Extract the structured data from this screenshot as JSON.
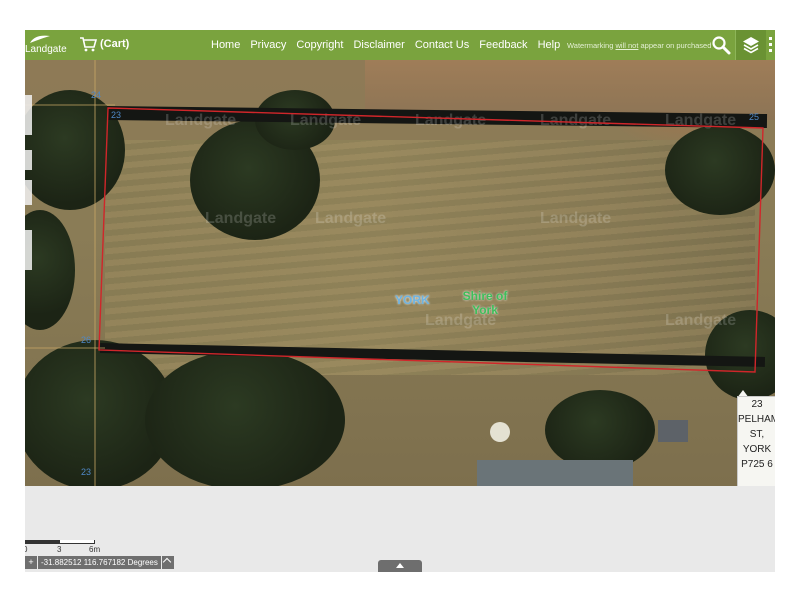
{
  "topbar": {
    "logo_text": "Landgate",
    "cart_label": "(Cart)",
    "nav": [
      "Home",
      "Privacy",
      "Copyright",
      "Disclaimer",
      "Contact Us",
      "Feedback",
      "Help"
    ],
    "watermark_notice": {
      "before": "Watermarking ",
      "emphasis": "will not",
      "after": " appear on purchased products"
    },
    "accent_color": "#7aa33e",
    "icons": [
      "cart-icon",
      "search-icon",
      "layers-icon",
      "more-icon"
    ]
  },
  "map": {
    "locality_label": "YORK",
    "lga_label_line1": "Shire of",
    "lga_label_line2": "York",
    "lot_numbers": [
      "23",
      "23",
      "25",
      "26",
      "24"
    ],
    "watermark_text": "Landgate",
    "boundary_color": "#d0262a"
  },
  "popup": {
    "lines": [
      "23",
      "PELHAM",
      "ST,",
      "YORK",
      "P725 6"
    ]
  },
  "scale": {
    "ticks": [
      "0",
      "3",
      "6m"
    ]
  },
  "coords": {
    "plus": "+",
    "value": "-31.882512 116.767182 Degrees"
  }
}
